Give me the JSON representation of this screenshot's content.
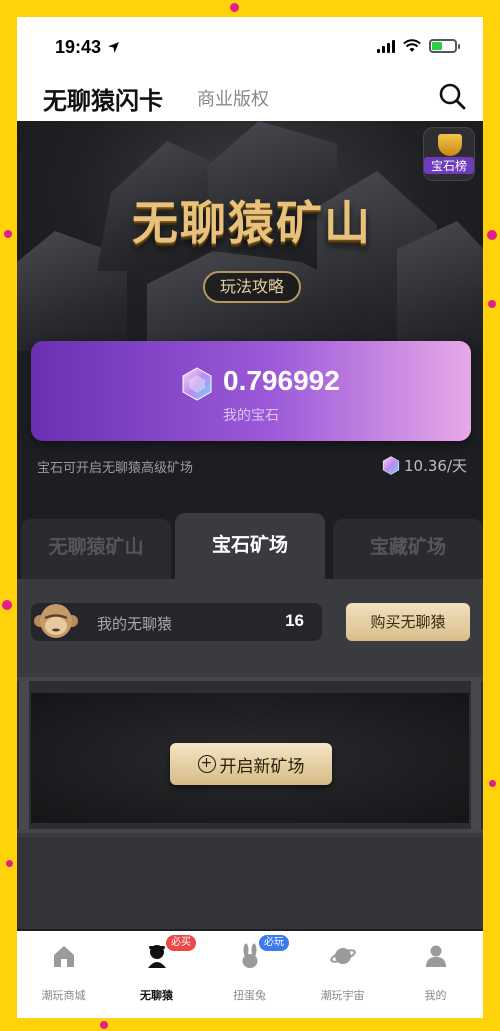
{
  "status_bar": {
    "time": "19:43"
  },
  "header": {
    "title": "无聊猿闪卡",
    "subtab": "商业版权"
  },
  "hero": {
    "title": "无聊猿矿山",
    "guide_button": "玩法攻略",
    "rank_label": "宝石榜"
  },
  "gem_card": {
    "value": "0.796992",
    "caption": "我的宝石"
  },
  "info": {
    "description": "宝石可开启无聊猿高级矿场",
    "rate": "10.36/天"
  },
  "tabs": [
    {
      "label": "无聊猿矿山",
      "active": false
    },
    {
      "label": "宝石矿场",
      "active": true
    },
    {
      "label": "宝藏矿场",
      "active": false
    }
  ],
  "monkeys": {
    "label": "我的无聊猿",
    "count": "16",
    "buy_button": "购买无聊猿"
  },
  "mine": {
    "open_button": "开启新矿场"
  },
  "bottom_nav": [
    {
      "label": "潮玩商城",
      "icon": "home-icon",
      "active": false,
      "badge": ""
    },
    {
      "label": "无聊猿",
      "icon": "ape-icon",
      "active": true,
      "badge": "必买"
    },
    {
      "label": "扭蛋兔",
      "icon": "rabbit-icon",
      "active": false,
      "badge": "必玩"
    },
    {
      "label": "潮玩宇宙",
      "icon": "planet-icon",
      "active": false,
      "badge": ""
    },
    {
      "label": "我的",
      "icon": "user-icon",
      "active": false,
      "badge": ""
    }
  ],
  "colors": {
    "frame": "#FFD20A",
    "accent_purple": "#9c5ad9",
    "gold": "#e8c27a",
    "badge_red": "#e84a4a",
    "badge_blue": "#3a7bf0"
  }
}
